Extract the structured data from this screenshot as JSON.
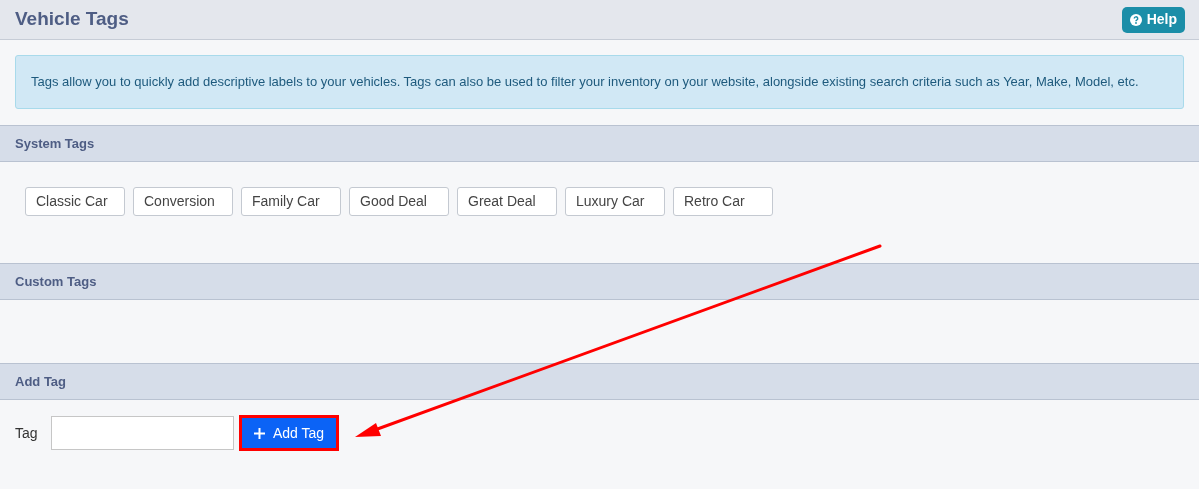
{
  "header": {
    "title": "Vehicle Tags",
    "help_button": "Help"
  },
  "info": "Tags allow you to quickly add descriptive labels to your vehicles. Tags can also be used to filter your inventory on your website, alongside existing search criteria such as Year, Make, Model, etc.",
  "system_tags": {
    "title": "System Tags",
    "tags": [
      "Classic Car",
      "Conversion",
      "Family Car",
      "Good Deal",
      "Great Deal",
      "Luxury Car",
      "Retro Car"
    ]
  },
  "custom_tags": {
    "title": "Custom Tags"
  },
  "add_tag": {
    "title": "Add Tag",
    "label": "Tag",
    "button": "Add Tag",
    "highlighted": true
  }
}
